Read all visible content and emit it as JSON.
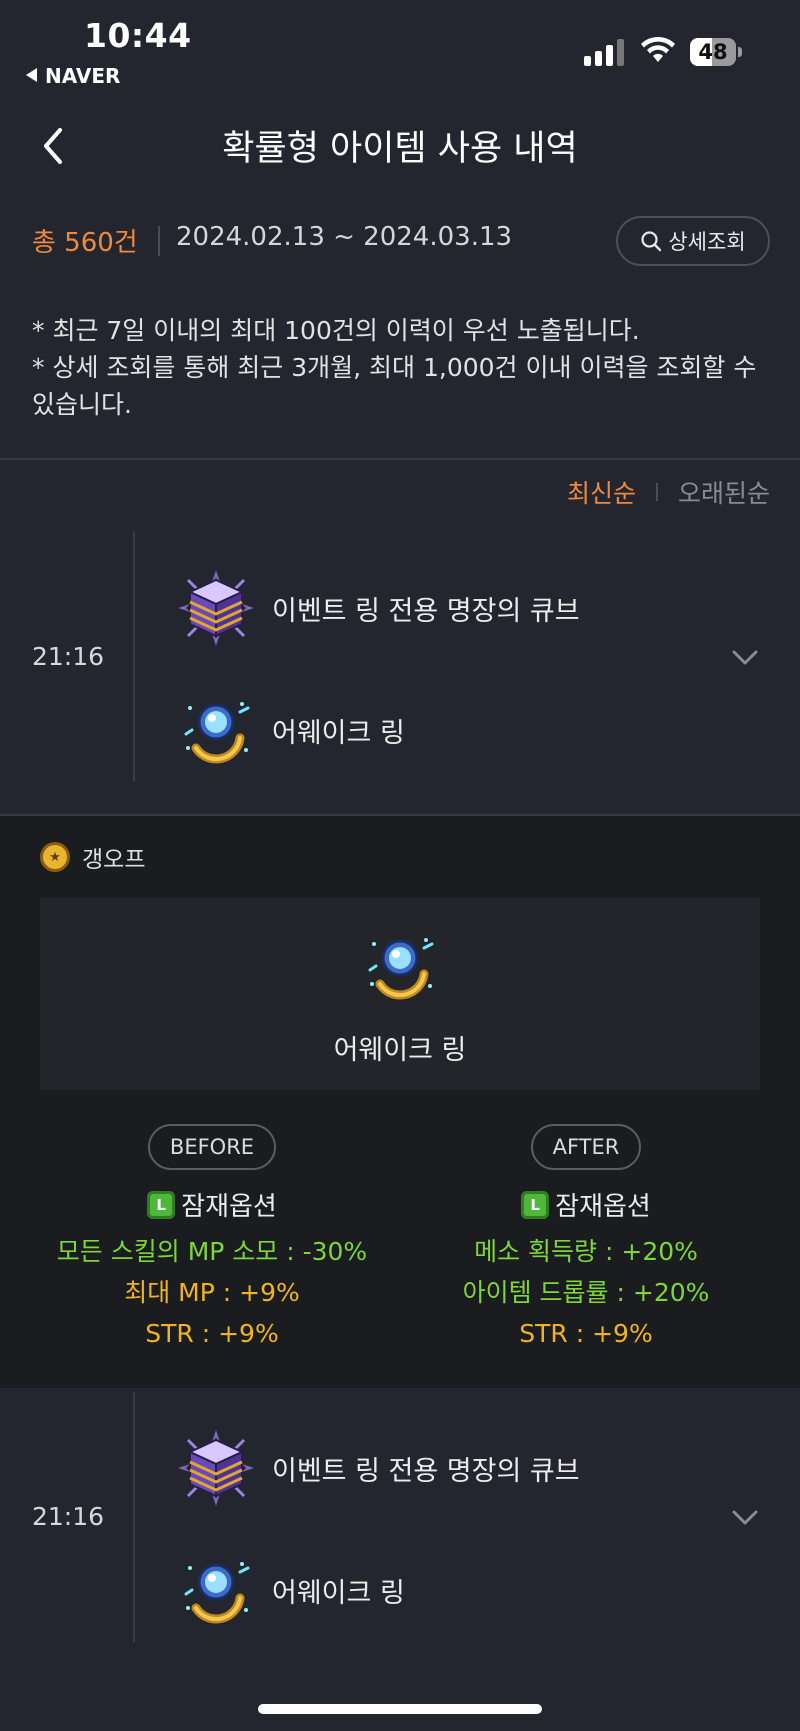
{
  "status_bar": {
    "time": "10:44",
    "back_app": "NAVER",
    "battery": "48",
    "battery_level": 0.48
  },
  "nav": {
    "title": "확률형 아이템 사용 내역"
  },
  "summary": {
    "total": "총 560건",
    "date_range": "2024.02.13 ~ 2024.03.13",
    "detail_search": "상세조회"
  },
  "notes": [
    "* 최근 7일 이내의 최대 100건의 이력이 우선 노출됩니다.",
    "* 상세 조회를 통해 최근 3개월, 최대 1,000건 이내 이력을 조회할 수 있습니다."
  ],
  "sort": {
    "newest": "최신순",
    "oldest": "오래된순"
  },
  "entries": [
    {
      "time": "21:16",
      "cube": "이벤트 링 전용 명장의 큐브",
      "item": "어웨이크 링",
      "icons": [
        "cube-icon",
        "ring-icon",
        "chevron-down-icon"
      ]
    },
    {
      "time": "21:16",
      "cube": "이벤트 링 전용 명장의 큐브",
      "item": "어웨이크 링",
      "icons": [
        "cube-icon",
        "ring-icon",
        "chevron-down-icon"
      ]
    }
  ],
  "expanded": {
    "character": "갱오프",
    "item_name": "어웨이크 링",
    "before": {
      "label": "BEFORE",
      "potential": "잠재옵션",
      "grade_badge": "L",
      "options": [
        "모든 스킬의 MP 소모 : -30%",
        "최대 MP : +9%",
        "STR : +9%"
      ]
    },
    "after": {
      "label": "AFTER",
      "potential": "잠재옵션",
      "grade_badge": "L",
      "options": [
        "메소 획득량 : +20%",
        "아이템 드롭률 : +20%",
        "STR : +9%"
      ]
    }
  },
  "colors": {
    "accent_orange": "#f0883e",
    "legendary_green": "#7ed63a",
    "option_gold": "#f0b422",
    "background": "#23262e"
  }
}
